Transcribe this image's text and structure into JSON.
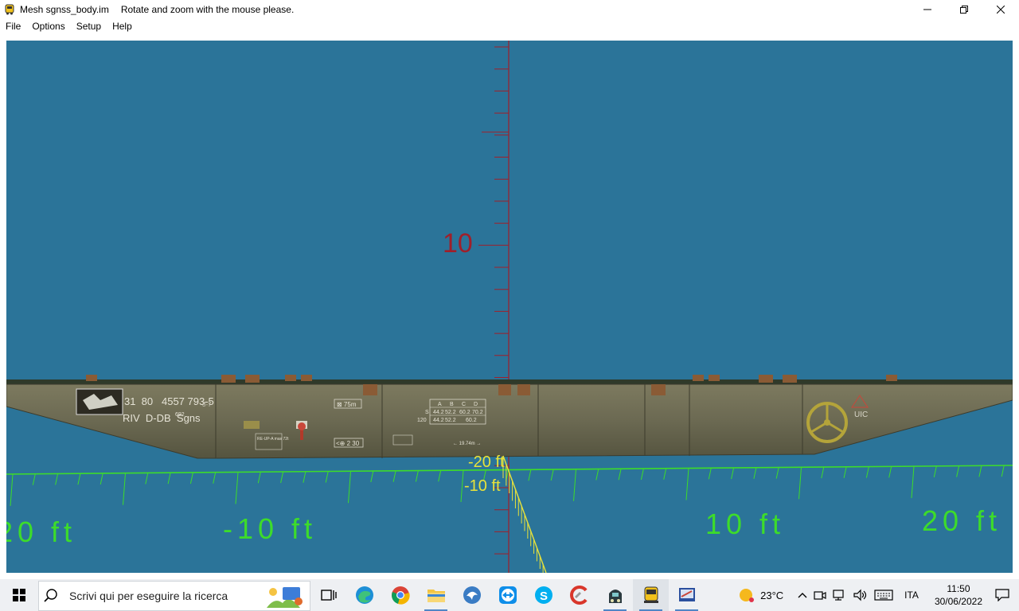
{
  "window": {
    "title": "Mesh sgnss_body.im",
    "subtitle": "Rotate and zoom with the mouse please."
  },
  "menu": [
    "File",
    "Options",
    "Setup",
    "Help"
  ],
  "viewport": {
    "background": "#2b7499",
    "vertical_axis_color": "#a01f2a",
    "ground_axis_color": "#3ddc2a",
    "depth_axis_color": "#e8e23a",
    "vertical_label": "10",
    "ground_labels": [
      "20 ft",
      "-10 ft",
      "10 ft",
      "20 ft"
    ],
    "depth_labels": [
      "-20 ft",
      "-10 ft"
    ],
    "wagon": {
      "number_line1": "31  80   4557 793-5",
      "number_line2": "RIV  D-DB  Sgns",
      "class_suffix": "692",
      "dash_suffix": "3-7",
      "load_header": [
        "A",
        "B",
        "C",
        "D"
      ],
      "load_row1": [
        "S",
        "44.2",
        "52.2",
        "60.2",
        "70.2"
      ],
      "load_row2": [
        "120",
        "44.2",
        "52.2",
        "",
        "60.2"
      ],
      "plate_75m": "⊠ 75m",
      "plate_230": "<⊕ 2 30",
      "plate_ren": "RE-UP-A max 72t",
      "length_note": "← 19.74m →",
      "uic_label": "UIC"
    }
  },
  "taskbar": {
    "search_placeholder": "Scrivi qui per eseguire la ricerca",
    "weather": "23°C",
    "language": "ITA",
    "time": "11:50",
    "date": "30/06/2022"
  }
}
